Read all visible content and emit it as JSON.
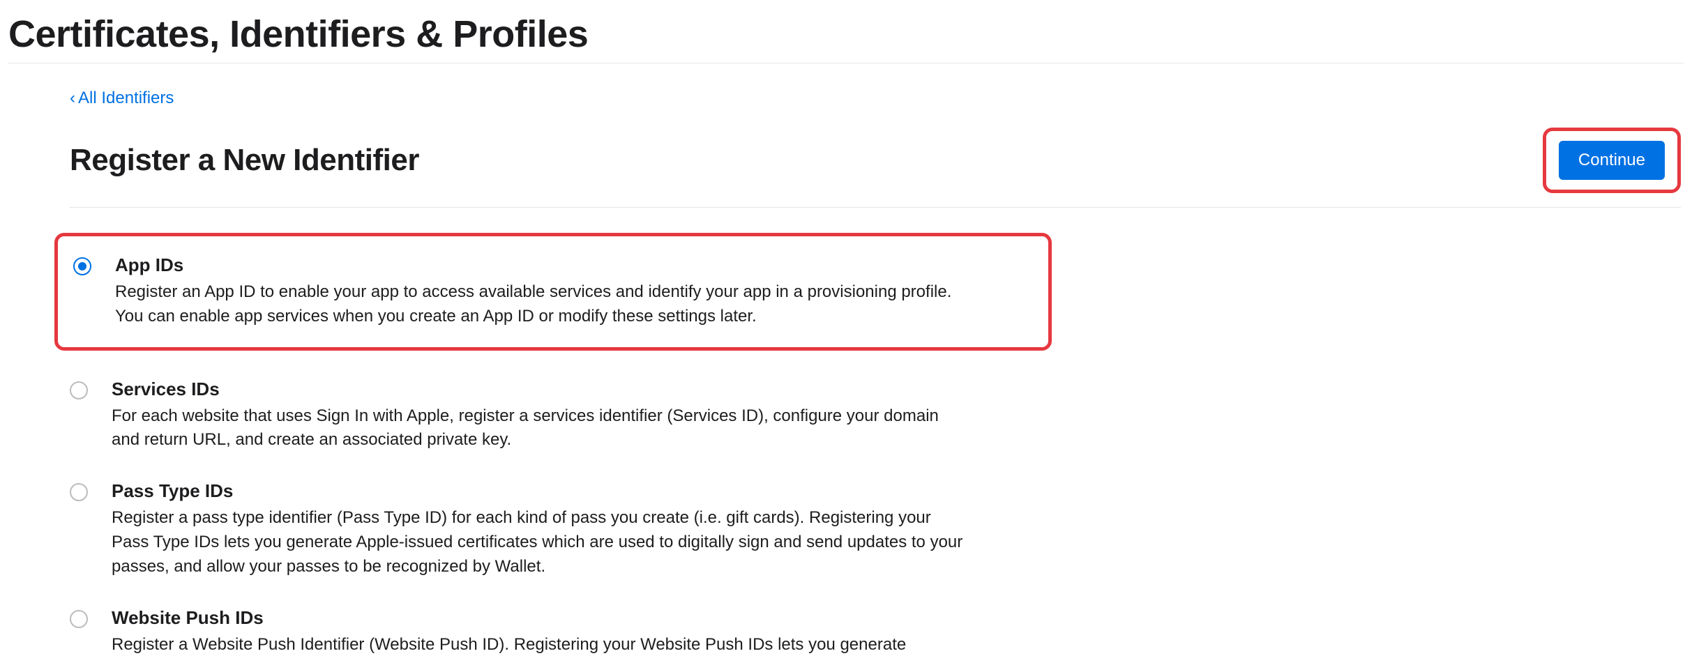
{
  "header": {
    "page_title": "Certificates, Identifiers & Profiles",
    "back_label": "All Identifiers",
    "section_title": "Register a New Identifier",
    "continue_label": "Continue"
  },
  "options": [
    {
      "id": "app-ids",
      "selected": true,
      "highlighted": true,
      "title": "App IDs",
      "description": "Register an App ID to enable your app to access available services and identify your app in a provisioning profile. You can enable app services when you create an App ID or modify these settings later."
    },
    {
      "id": "services-ids",
      "selected": false,
      "highlighted": false,
      "title": "Services IDs",
      "description": "For each website that uses Sign In with Apple, register a services identifier (Services ID), configure your domain and return URL, and create an associated private key."
    },
    {
      "id": "pass-type-ids",
      "selected": false,
      "highlighted": false,
      "title": "Pass Type IDs",
      "description": "Register a pass type identifier (Pass Type ID) for each kind of pass you create (i.e. gift cards). Registering your Pass Type IDs lets you generate Apple-issued certificates which are used to digitally sign and send updates to your passes, and allow your passes to be recognized by Wallet."
    },
    {
      "id": "website-push-ids",
      "selected": false,
      "highlighted": false,
      "title": "Website Push IDs",
      "description": "Register a Website Push Identifier (Website Push ID). Registering your Website Push IDs lets you generate"
    }
  ],
  "annotations": {
    "continue_highlighted": true
  }
}
